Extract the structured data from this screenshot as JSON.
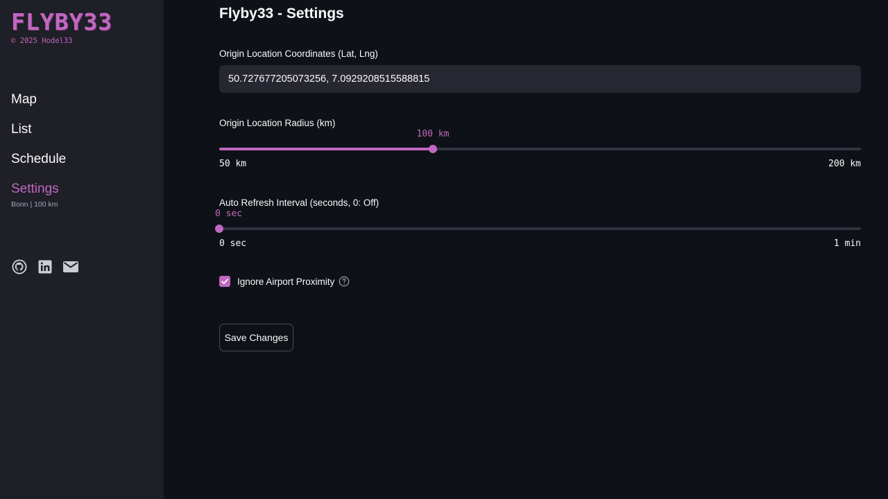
{
  "sidebar": {
    "logo": "FLYBY33",
    "copyright": "© 2025 Hodel33",
    "nav": [
      {
        "label": "Map"
      },
      {
        "label": "List"
      },
      {
        "label": "Schedule"
      },
      {
        "label": "Settings",
        "sub": "Bonn | 100 km",
        "active": true
      }
    ],
    "social": [
      "github-icon",
      "linkedin-icon",
      "mail-icon"
    ]
  },
  "main": {
    "title": "Flyby33 - Settings",
    "origin_coords": {
      "label": "Origin Location Coordinates (Lat, Lng)",
      "value": "50.727677205073256, 7.0929208515588815"
    },
    "radius": {
      "label": "Origin Location Radius (km)",
      "value_label": "100 km",
      "min_label": "50 km",
      "max_label": "200 km",
      "min": 50,
      "max": 200,
      "value": 100
    },
    "refresh": {
      "label": "Auto Refresh Interval (seconds, 0: Off)",
      "value_label": "0 sec",
      "min_label": "0 sec",
      "max_label": "1 min",
      "min": 0,
      "max": 60,
      "value": 0
    },
    "ignore_airport": {
      "label": "Ignore Airport Proximity",
      "checked": true
    },
    "save_label": "Save Changes"
  },
  "colors": {
    "accent": "#c168c0",
    "background": "#0e1117",
    "sidebar": "#1f1f27"
  }
}
